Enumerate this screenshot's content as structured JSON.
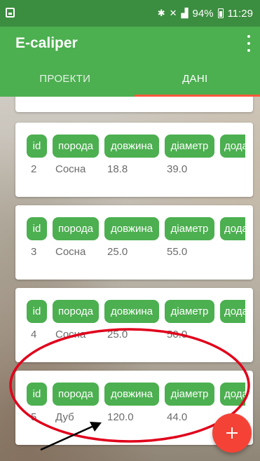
{
  "status_bar": {
    "battery": "94%",
    "time": "11:29",
    "icons": [
      "notification-icon",
      "bluetooth-icon",
      "mute-icon",
      "signal-icon",
      "battery-icon"
    ]
  },
  "app_bar": {
    "title": "E-caliper",
    "menu_icon": "overflow-menu-icon"
  },
  "tabs": [
    {
      "label": "ПРОЕКТИ",
      "active": false
    },
    {
      "label": "ДАНІ",
      "active": true
    }
  ],
  "columns": [
    "id",
    "порода",
    "довжина",
    "діаметр",
    "дода"
  ],
  "records": [
    {
      "id": "2",
      "poroda": "Сосна",
      "dovzhyna": "18.8",
      "diametr": "39.0"
    },
    {
      "id": "3",
      "poroda": "Сосна",
      "dovzhyna": "25.0",
      "diametr": "55.0"
    },
    {
      "id": "4",
      "poroda": "Сосна",
      "dovzhyna": "25.0",
      "diametr": "50.0"
    },
    {
      "id": "5",
      "poroda": "Дуб",
      "dovzhyna": "120.0",
      "diametr": "44.0"
    }
  ],
  "colors": {
    "status_bar": "#3b8d3f",
    "primary": "#4caf50",
    "accent": "#f44336",
    "tab_indicator": "#ff5a3c",
    "annotation": "#e0001b"
  },
  "fab": {
    "icon": "plus-icon"
  }
}
